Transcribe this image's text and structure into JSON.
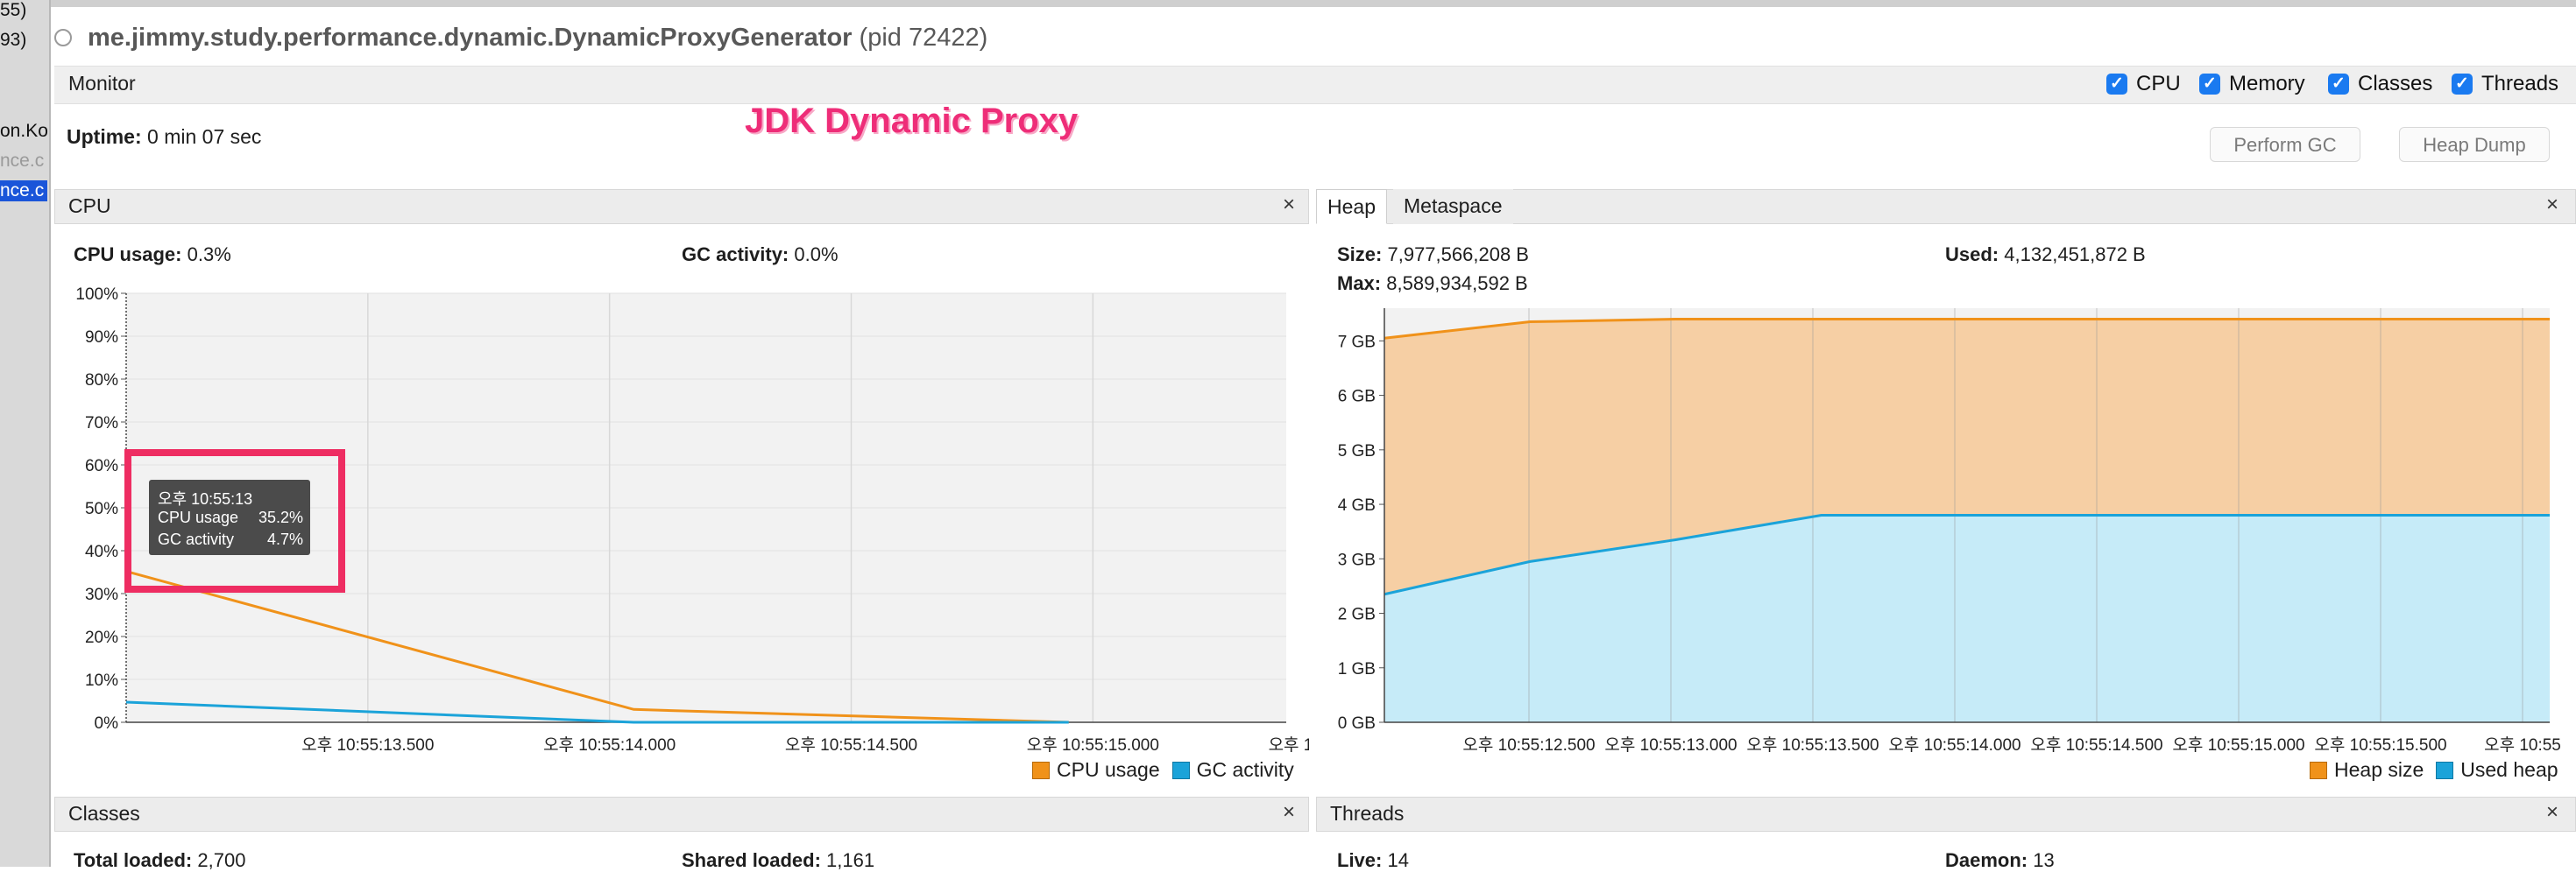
{
  "left_strip": {
    "lines": [
      "55)",
      "93)",
      "on.Ko",
      "nce.c",
      "nce.c"
    ]
  },
  "window": {
    "title": "me.jimmy.study.performance.dynamic.DynamicProxyGenerator",
    "pid": "(pid 72422)"
  },
  "monitor": {
    "label": "Monitor",
    "checkboxes": [
      {
        "label": "CPU",
        "checked": true
      },
      {
        "label": "Memory",
        "checked": true
      },
      {
        "label": "Classes",
        "checked": true
      },
      {
        "label": "Threads",
        "checked": true
      }
    ],
    "uptime_label": "Uptime:",
    "uptime_value": "0 min 07 sec",
    "annotation": "JDK Dynamic Proxy",
    "perform_gc": "Perform GC",
    "heap_dump": "Heap Dump"
  },
  "cpu_panel": {
    "title": "CPU",
    "close": "×",
    "cpu_usage_label": "CPU usage:",
    "cpu_usage_value": "0.3%",
    "gc_activity_label": "GC activity:",
    "gc_activity_value": "0.0%",
    "tooltip": {
      "time": "오후 10:55:13",
      "cpu_label": "CPU usage",
      "cpu_value": "35.2%",
      "gc_label": "GC activity",
      "gc_value": "4.7%"
    },
    "legend": [
      {
        "label": "CPU usage",
        "color": "#f0921a"
      },
      {
        "label": "GC activity",
        "color": "#1ba3d9"
      }
    ]
  },
  "heap_panel": {
    "tabs": [
      "Heap",
      "Metaspace"
    ],
    "close": "×",
    "size_label": "Size:",
    "size_value": "7,977,566,208 B",
    "max_label": "Max:",
    "max_value": "8,589,934,592 B",
    "used_label": "Used:",
    "used_value": "4,132,451,872 B",
    "legend": [
      {
        "label": "Heap size",
        "color": "#f0921a"
      },
      {
        "label": "Used heap",
        "color": "#1ba3d9"
      }
    ]
  },
  "classes_panel": {
    "title": "Classes",
    "close": "×",
    "total_loaded_label": "Total loaded:",
    "total_loaded_value": "2,700",
    "shared_loaded_label": "Shared loaded:",
    "shared_loaded_value": "1,161"
  },
  "threads_panel": {
    "title": "Threads",
    "close": "×",
    "live_label": "Live:",
    "live_value": "14",
    "daemon_label": "Daemon:",
    "daemon_value": "13"
  },
  "chart_data": [
    {
      "type": "line",
      "title": "CPU",
      "x_ticks": [
        "오후 10:55:13.500",
        "오후 10:55:14.000",
        "오후 10:55:14.500",
        "오후 10:55:15.000",
        "오후 10:55:15.500",
        "오후 10:55:"
      ],
      "y_ticks": [
        "100%",
        "90%",
        "80%",
        "70%",
        "60%",
        "50%",
        "40%",
        "30%",
        "20%",
        "10%",
        "0%"
      ],
      "ylim": [
        0,
        100
      ],
      "x_seconds_after_10_55_13": [
        0,
        1.05,
        1.95
      ],
      "series": [
        {
          "name": "CPU usage",
          "color": "#f0921a",
          "values": [
            35.2,
            3.0,
            0.0
          ],
          "x": [
            0,
            1.05,
            1.95
          ]
        },
        {
          "name": "GC activity",
          "color": "#1ba3d9",
          "values": [
            4.7,
            0.0,
            0.0
          ],
          "x": [
            0,
            1.05,
            1.95
          ]
        }
      ],
      "legend_position": "bottom-right"
    },
    {
      "type": "area",
      "title": "Heap",
      "x_ticks": [
        "오후 10:55:12.500",
        "오후 10:55:13.000",
        "오후 10:55:13.500",
        "오후 10:55:14.000",
        "오후 10:55:14.500",
        "오후 10:55:15.000",
        "오후 10:55:15.500",
        "오후 10:55"
      ],
      "y_ticks": [
        "7 GB",
        "6 GB",
        "5 GB",
        "4 GB",
        "3 GB",
        "2 GB",
        "1 GB",
        "0 GB"
      ],
      "ylim": [
        0,
        7.6
      ],
      "series": [
        {
          "name": "Heap size",
          "color": "#f0921a",
          "values_gb": [
            7.05,
            7.35,
            7.4,
            7.4,
            7.4,
            7.4,
            7.4,
            7.4,
            7.4
          ]
        },
        {
          "name": "Used heap",
          "color": "#1ba3d9",
          "values_gb": [
            2.35,
            2.95,
            3.35,
            3.8,
            3.8,
            3.8,
            3.8,
            3.8,
            3.8
          ]
        }
      ],
      "legend_position": "bottom-right"
    }
  ]
}
